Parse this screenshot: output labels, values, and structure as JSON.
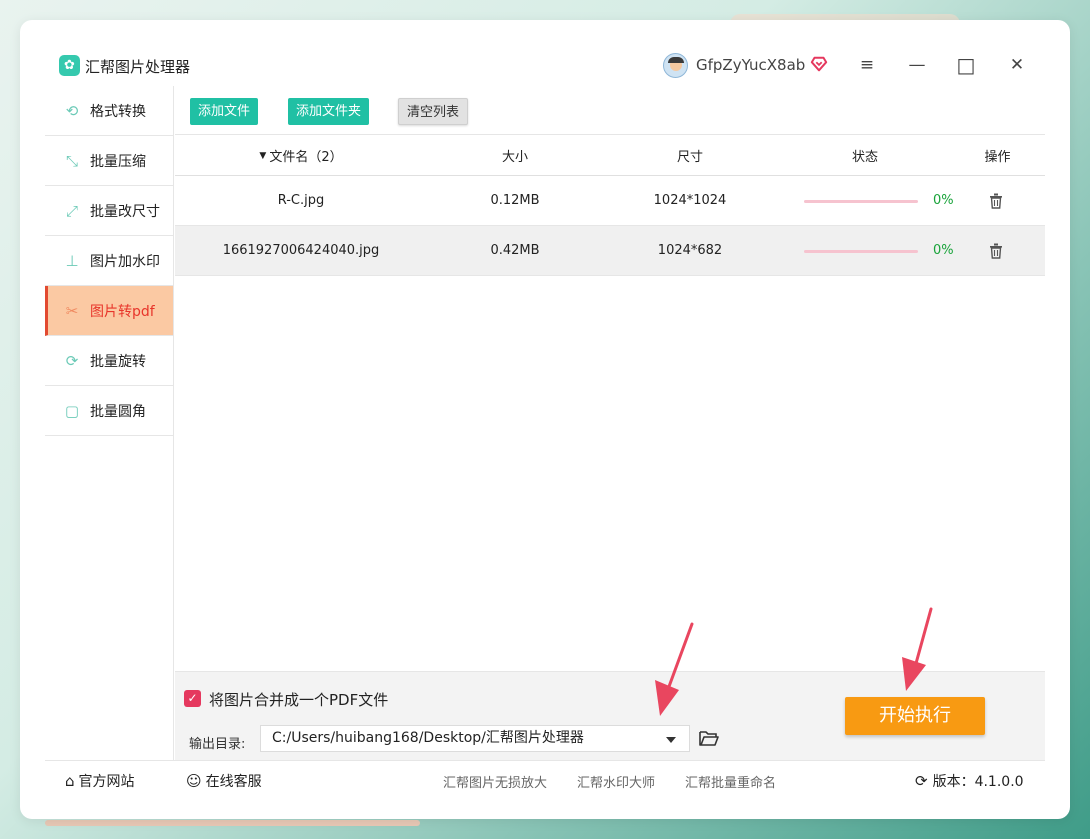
{
  "window": {
    "title": "汇帮图片处理器",
    "username": "GfpZyYucX8ab",
    "menu_glyph": "≡",
    "minimize_glyph": "—",
    "maximize_glyph": "□",
    "close_glyph": "✕"
  },
  "sidebar": {
    "items": [
      {
        "label": "格式转换",
        "icon": "format-convert-icon"
      },
      {
        "label": "批量压缩",
        "icon": "compress-icon"
      },
      {
        "label": "批量改尺寸",
        "icon": "resize-icon"
      },
      {
        "label": "图片加水印",
        "icon": "watermark-icon"
      },
      {
        "label": "图片转pdf",
        "icon": "pdf-icon",
        "active": true
      },
      {
        "label": "批量旋转",
        "icon": "rotate-icon"
      },
      {
        "label": "批量圆角",
        "icon": "round-corner-icon"
      }
    ]
  },
  "toolbar": {
    "add_file": "添加文件",
    "add_folder": "添加文件夹",
    "clear_list": "清空列表"
  },
  "table": {
    "headers": {
      "name": "文件名（2）",
      "size": "大小",
      "dimensions": "尺寸",
      "status": "状态",
      "actions": "操作"
    },
    "rows": [
      {
        "name": "R-C.jpg",
        "size": "0.12MB",
        "dimensions": "1024*1024",
        "progress": 0,
        "percent": "0%"
      },
      {
        "name": "1661927006424040.jpg",
        "size": "0.42MB",
        "dimensions": "1024*682",
        "progress": 0,
        "percent": "0%"
      }
    ]
  },
  "options": {
    "merge_checked": true,
    "merge_label": "将图片合并成一个PDF文件",
    "output_label": "输出目录:",
    "output_path": "C:/Users/huibang168/Desktop/汇帮图片处理器",
    "start_button": "开始执行"
  },
  "footer": {
    "website": "官方网站",
    "support": "在线客服",
    "link1": "汇帮图片无损放大",
    "link2": "汇帮水印大师",
    "link3": "汇帮批量重命名",
    "version": "版本：4.1.0.0"
  },
  "colors": {
    "accent": "#20c0a4",
    "start": "#f89a12",
    "active_bg": "#fbc9a3",
    "active_text": "#e8352a",
    "annotation_arrow": "#e9465f"
  }
}
